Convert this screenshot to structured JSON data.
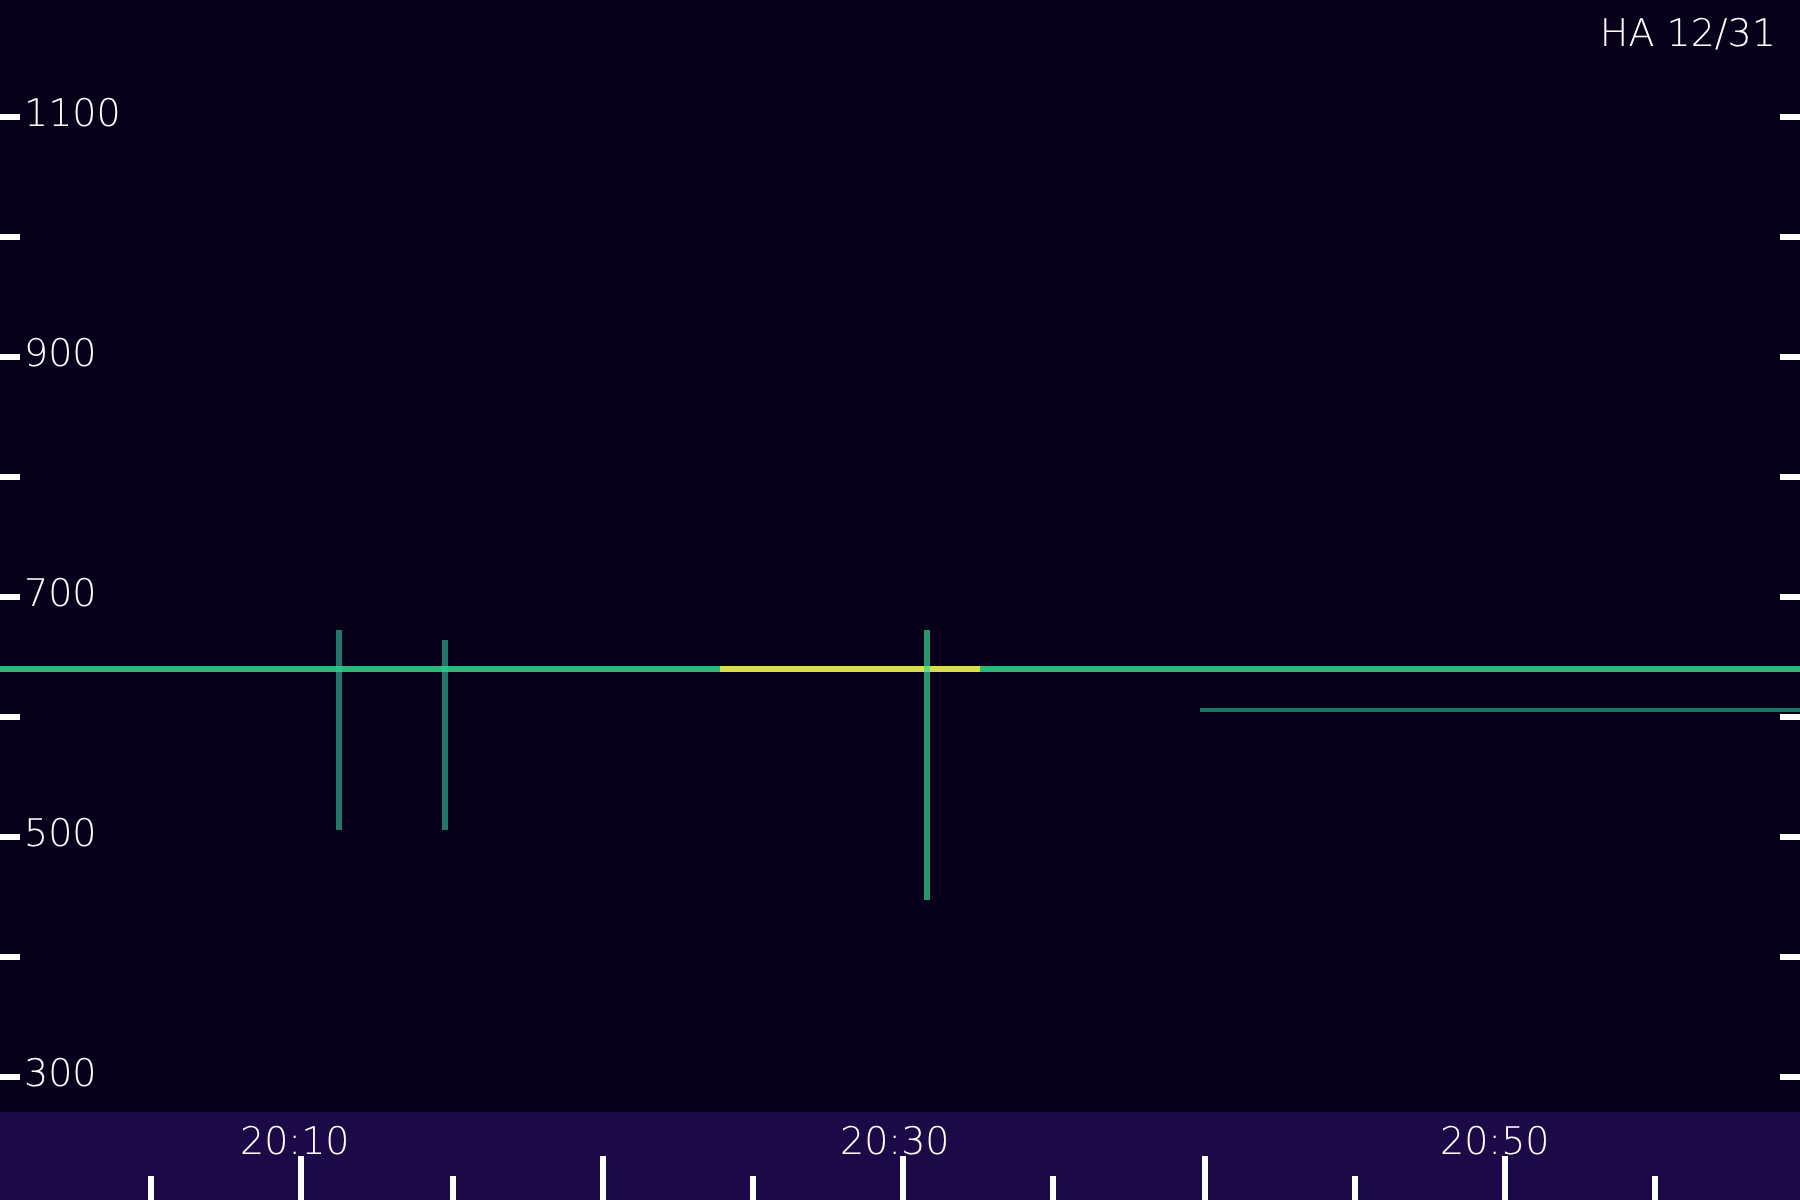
{
  "title": "HA 12/31",
  "y_axis": {
    "labels": [
      "1100",
      "900",
      "700",
      "500",
      "300"
    ]
  },
  "x_axis": {
    "labels": [
      "20:10",
      "20:30",
      "20:50"
    ]
  }
}
